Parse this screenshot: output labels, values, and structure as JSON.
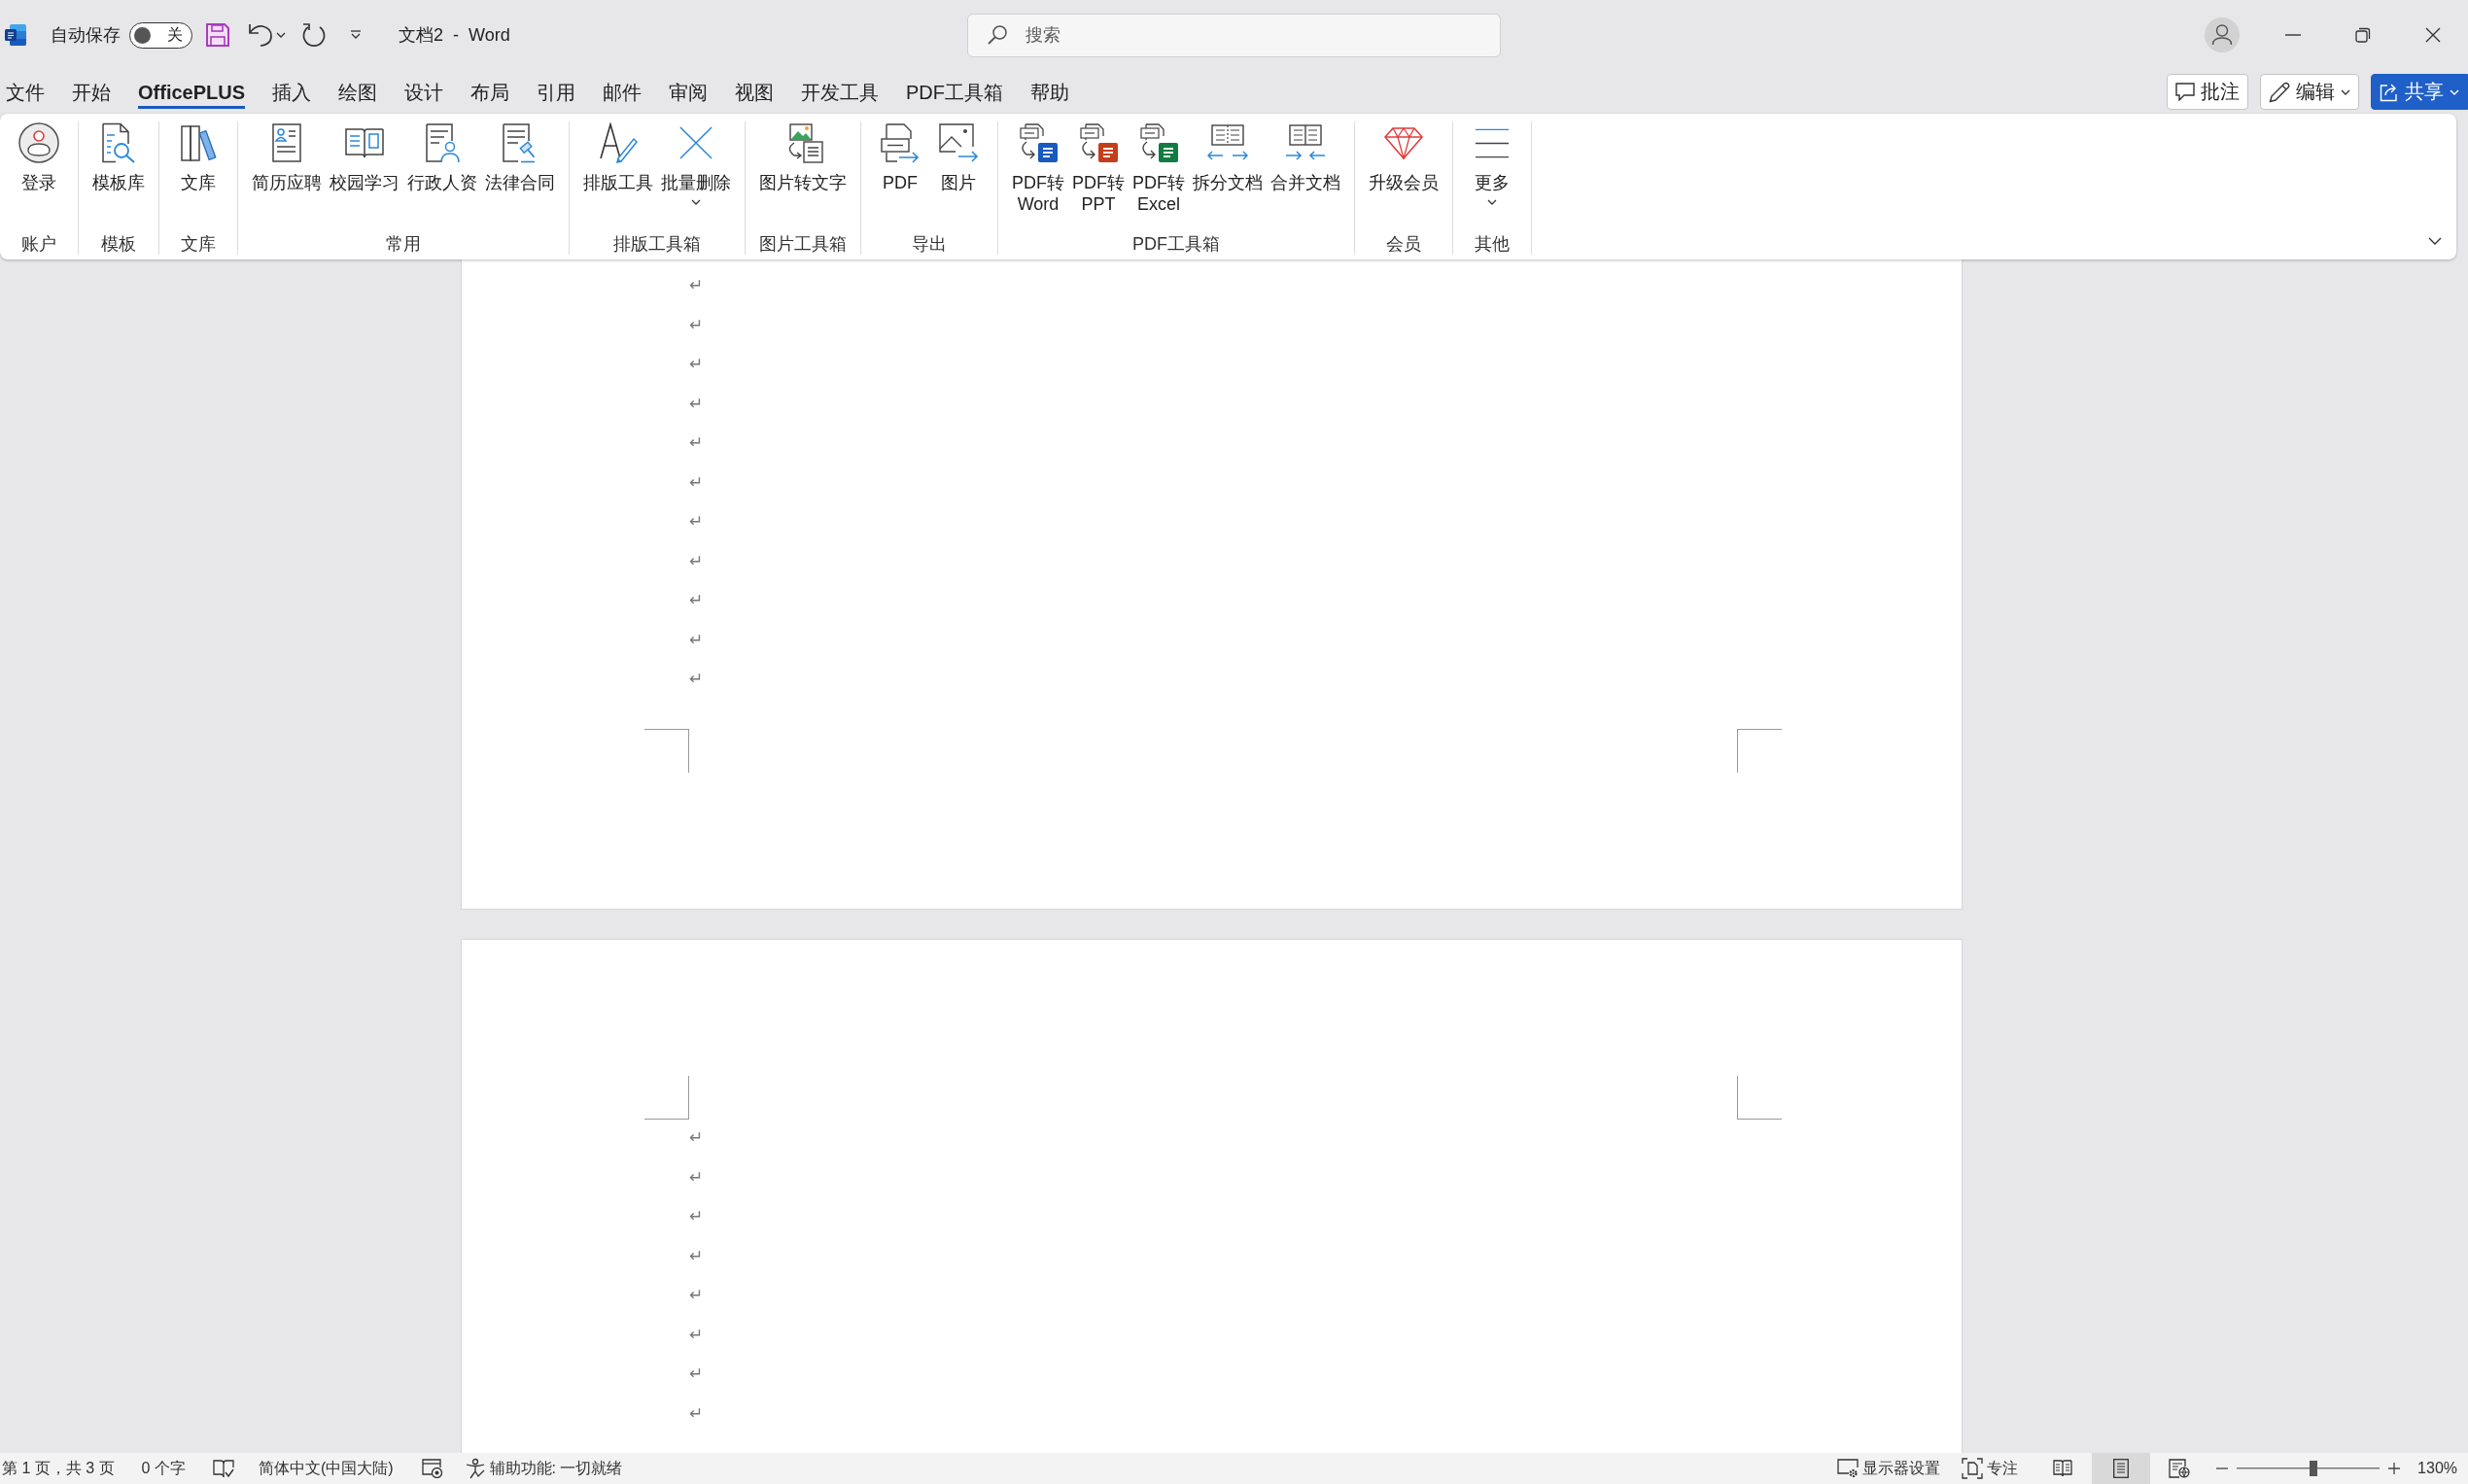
{
  "title_bar": {
    "autosave": {
      "label": "自动保存",
      "on": false,
      "state_label": "关"
    },
    "title": "文档2 - Word",
    "search": {
      "placeholder": "搜索"
    }
  },
  "menu": {
    "tabs": [
      {
        "label": "文件",
        "selected": false
      },
      {
        "label": "开始",
        "selected": false
      },
      {
        "label": "OfficePLUS",
        "selected": true
      },
      {
        "label": "插入",
        "selected": false
      },
      {
        "label": "绘图",
        "selected": false
      },
      {
        "label": "设计",
        "selected": false
      },
      {
        "label": "布局",
        "selected": false
      },
      {
        "label": "引用",
        "selected": false
      },
      {
        "label": "邮件",
        "selected": false
      },
      {
        "label": "审阅",
        "selected": false
      },
      {
        "label": "视图",
        "selected": false
      },
      {
        "label": "开发工具",
        "selected": false
      },
      {
        "label": "PDF工具箱",
        "selected": false
      },
      {
        "label": "帮助",
        "selected": false
      }
    ],
    "actions": [
      {
        "kind": "comments",
        "label": "批注",
        "dropdown": false
      },
      {
        "kind": "editing",
        "label": "编辑",
        "dropdown": true
      },
      {
        "kind": "share",
        "label": "共享",
        "dropdown": true
      }
    ]
  },
  "ribbon": {
    "groups": [
      {
        "label": "账户",
        "buttons": [
          {
            "kind": "account",
            "lines": [
              "登录"
            ],
            "dropdown": false
          }
        ]
      },
      {
        "label": "模板",
        "buttons": [
          {
            "kind": "templates",
            "lines": [
              "模板库"
            ],
            "dropdown": false
          }
        ]
      },
      {
        "label": "文库",
        "buttons": [
          {
            "kind": "library",
            "lines": [
              "文库"
            ],
            "dropdown": false
          }
        ]
      },
      {
        "label": "常用",
        "buttons": [
          {
            "kind": "resume",
            "lines": [
              "简历应聘"
            ],
            "dropdown": false
          },
          {
            "kind": "campus",
            "lines": [
              "校园学习"
            ],
            "dropdown": false
          },
          {
            "kind": "hr",
            "lines": [
              "行政人资"
            ],
            "dropdown": false
          },
          {
            "kind": "legal",
            "lines": [
              "法律合同"
            ],
            "dropdown": false
          }
        ]
      },
      {
        "label": "排版工具箱",
        "buttons": [
          {
            "kind": "layout",
            "lines": [
              "排版工具"
            ],
            "dropdown": false
          },
          {
            "kind": "erase",
            "lines": [
              "批量删除"
            ],
            "dropdown": true
          }
        ]
      },
      {
        "label": "图片工具箱",
        "buttons": [
          {
            "kind": "ocr",
            "lines": [
              "图片转文字"
            ],
            "dropdown": false
          }
        ]
      },
      {
        "label": "导出",
        "buttons": [
          {
            "kind": "pdf",
            "lines": [
              "PDF"
            ],
            "dropdown": false
          },
          {
            "kind": "picture",
            "lines": [
              "图片"
            ],
            "dropdown": false
          }
        ]
      },
      {
        "label": "PDF工具箱",
        "buttons": [
          {
            "kind": "toword",
            "lines": [
              "PDF转",
              "Word"
            ],
            "dropdown": false
          },
          {
            "kind": "toppt",
            "lines": [
              "PDF转",
              "PPT"
            ],
            "dropdown": false
          },
          {
            "kind": "toexcel",
            "lines": [
              "PDF转",
              "Excel"
            ],
            "dropdown": false
          },
          {
            "kind": "split",
            "lines": [
              "拆分文档"
            ],
            "dropdown": false
          },
          {
            "kind": "merge",
            "lines": [
              "合并文档"
            ],
            "dropdown": false
          }
        ]
      },
      {
        "label": "会员",
        "buttons": [
          {
            "kind": "vip",
            "lines": [
              "升级会员"
            ],
            "dropdown": false
          }
        ]
      },
      {
        "label": "其他",
        "buttons": [
          {
            "kind": "more",
            "lines": [
              "更多"
            ],
            "dropdown": true
          }
        ]
      }
    ]
  },
  "pages": [
    {
      "paragraph_marks": [
        "↵",
        "↵",
        "↵",
        "↵",
        "↵",
        "↵",
        "↵",
        "↵",
        "↵",
        "↵",
        "↵"
      ]
    },
    {
      "paragraph_marks": [
        "↵",
        "↵",
        "↵",
        "↵",
        "↵",
        "↵",
        "↵",
        "↵"
      ]
    }
  ],
  "status_bar": {
    "page_info": "第 1 页，共 3 页",
    "word_count": "0 个字",
    "language": "简体中文(中国大陆)",
    "accessibility": "辅助功能: 一切就绪",
    "display_settings": "显示器设置",
    "focus": "专注",
    "views": [
      {
        "kind": "read",
        "selected": false
      },
      {
        "kind": "print",
        "selected": true
      },
      {
        "kind": "web",
        "selected": false
      }
    ],
    "zoom": {
      "level": 0.54,
      "reading": "130%"
    }
  }
}
